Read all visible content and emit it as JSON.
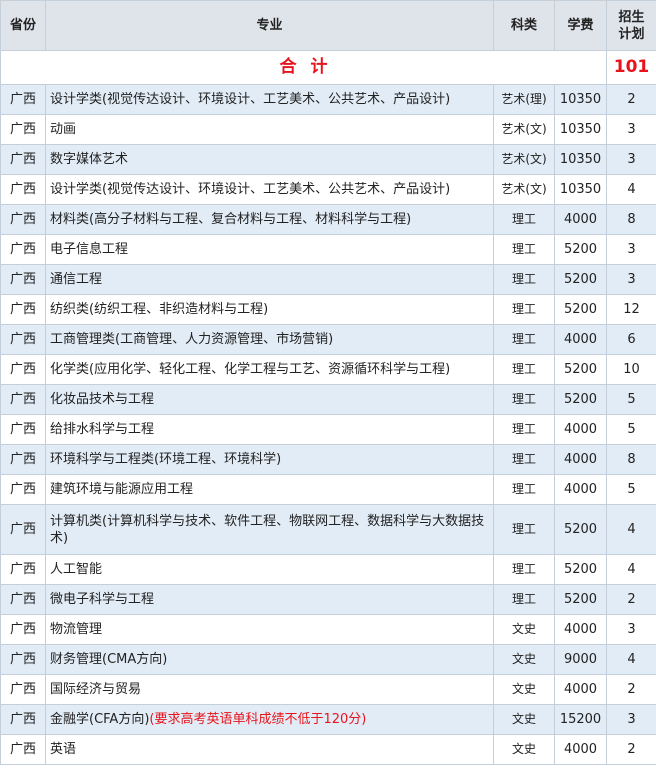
{
  "headers": {
    "province": "省份",
    "major": "专业",
    "category": "科类",
    "fee": "学费",
    "plan_line1": "招生",
    "plan_line2": "计划"
  },
  "total": {
    "label": "合计",
    "value": "101"
  },
  "colors": {
    "header_bg": "#dfe3ea",
    "stripe_bg": "#e2ecf6",
    "accent_red": "#e8141c",
    "border": "#c5cfd9"
  },
  "rows": [
    {
      "province": "广西",
      "major": "设计学类(视觉传达设计、环境设计、工艺美术、公共艺术、产品设计)",
      "note": "",
      "category": "艺术(理)",
      "fee": "10350",
      "plan": "2"
    },
    {
      "province": "广西",
      "major": "动画",
      "note": "",
      "category": "艺术(文)",
      "fee": "10350",
      "plan": "3"
    },
    {
      "province": "广西",
      "major": "数字媒体艺术",
      "note": "",
      "category": "艺术(文)",
      "fee": "10350",
      "plan": "3"
    },
    {
      "province": "广西",
      "major": "设计学类(视觉传达设计、环境设计、工艺美术、公共艺术、产品设计)",
      "note": "",
      "category": "艺术(文)",
      "fee": "10350",
      "plan": "4"
    },
    {
      "province": "广西",
      "major": "材料类(高分子材料与工程、复合材料与工程、材料科学与工程)",
      "note": "",
      "category": "理工",
      "fee": "4000",
      "plan": "8"
    },
    {
      "province": "广西",
      "major": "电子信息工程",
      "note": "",
      "category": "理工",
      "fee": "5200",
      "plan": "3"
    },
    {
      "province": "广西",
      "major": "通信工程",
      "note": "",
      "category": "理工",
      "fee": "5200",
      "plan": "3"
    },
    {
      "province": "广西",
      "major": "纺织类(纺织工程、非织造材料与工程)",
      "note": "",
      "category": "理工",
      "fee": "5200",
      "plan": "12"
    },
    {
      "province": "广西",
      "major": "工商管理类(工商管理、人力资源管理、市场营销)",
      "note": "",
      "category": "理工",
      "fee": "4000",
      "plan": "6"
    },
    {
      "province": "广西",
      "major": "化学类(应用化学、轻化工程、化学工程与工艺、资源循环科学与工程)",
      "note": "",
      "category": "理工",
      "fee": "5200",
      "plan": "10"
    },
    {
      "province": "广西",
      "major": "化妆品技术与工程",
      "note": "",
      "category": "理工",
      "fee": "5200",
      "plan": "5"
    },
    {
      "province": "广西",
      "major": "给排水科学与工程",
      "note": "",
      "category": "理工",
      "fee": "4000",
      "plan": "5"
    },
    {
      "province": "广西",
      "major": "环境科学与工程类(环境工程、环境科学)",
      "note": "",
      "category": "理工",
      "fee": "4000",
      "plan": "8"
    },
    {
      "province": "广西",
      "major": "建筑环境与能源应用工程",
      "note": "",
      "category": "理工",
      "fee": "4000",
      "plan": "5"
    },
    {
      "province": "广西",
      "major": "计算机类(计算机科学与技术、软件工程、物联网工程、数据科学与大数据技术)",
      "note": "",
      "category": "理工",
      "fee": "5200",
      "plan": "4"
    },
    {
      "province": "广西",
      "major": "人工智能",
      "note": "",
      "category": "理工",
      "fee": "5200",
      "plan": "4"
    },
    {
      "province": "广西",
      "major": "微电子科学与工程",
      "note": "",
      "category": "理工",
      "fee": "5200",
      "plan": "2"
    },
    {
      "province": "广西",
      "major": "物流管理",
      "note": "",
      "category": "文史",
      "fee": "4000",
      "plan": "3"
    },
    {
      "province": "广西",
      "major": "财务管理(CMA方向)",
      "note": "",
      "category": "文史",
      "fee": "9000",
      "plan": "4"
    },
    {
      "province": "广西",
      "major": "国际经济与贸易",
      "note": "",
      "category": "文史",
      "fee": "4000",
      "plan": "2"
    },
    {
      "province": "广西",
      "major": "金融学(CFA方向)",
      "note": "(要求高考英语单科成绩不低于120分)",
      "category": "文史",
      "fee": "15200",
      "plan": "3"
    },
    {
      "province": "广西",
      "major": "英语",
      "note": "",
      "category": "文史",
      "fee": "4000",
      "plan": "2"
    }
  ]
}
